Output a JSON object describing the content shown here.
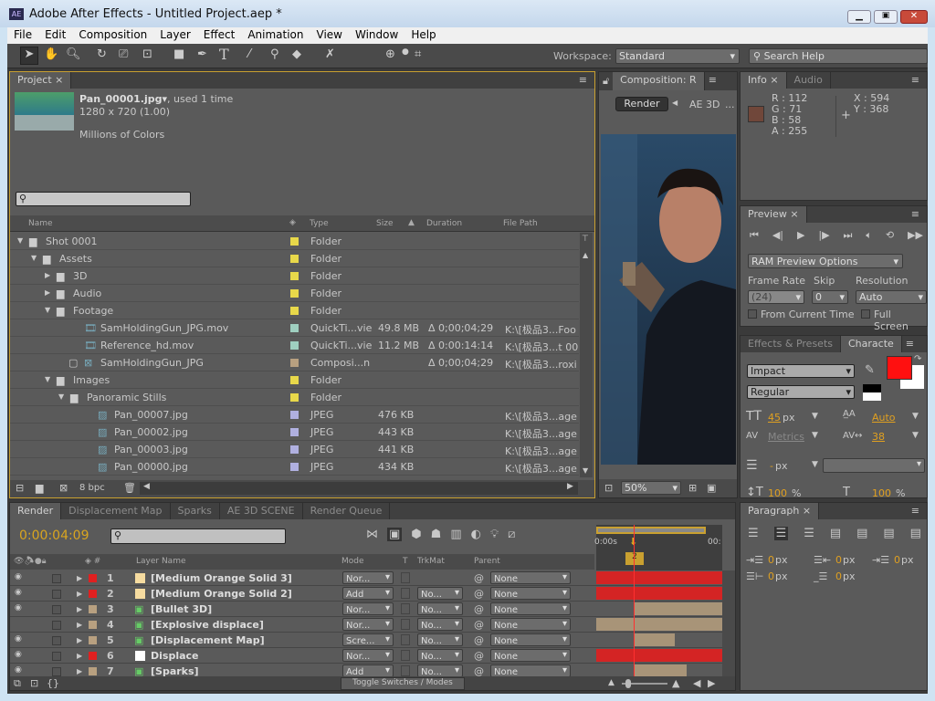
{
  "window": {
    "title": "Adobe After Effects - Untitled Project.aep *",
    "app_icon": "AE"
  },
  "menu": [
    "File",
    "Edit",
    "Composition",
    "Layer",
    "Effect",
    "Animation",
    "View",
    "Window",
    "Help"
  ],
  "toolbar": {
    "workspace_label": "Workspace:",
    "workspace_value": "Standard",
    "search_placeholder": "Search Help"
  },
  "project": {
    "tab": "Project",
    "item_name": "Pan_00001.jpg▾",
    "item_used": ", used 1 time",
    "item_dims": "1280 x 720 (1.00)",
    "item_colors": "Millions of Colors",
    "search_value": "",
    "bpc": "8 bpc",
    "columns": [
      "Name",
      "Type",
      "Size",
      "Duration",
      "File Path"
    ],
    "rows": [
      {
        "name": "Shot 0001",
        "indent": 0,
        "kind": "folder",
        "twirl": "open",
        "color": "#e8d84a",
        "type": "Folder",
        "size": "",
        "duration": "",
        "path": ""
      },
      {
        "name": "Assets",
        "indent": 1,
        "kind": "folder",
        "twirl": "open",
        "color": "#e8d84a",
        "type": "Folder",
        "size": "",
        "duration": "",
        "path": ""
      },
      {
        "name": "3D",
        "indent": 2,
        "kind": "folder",
        "twirl": "closed",
        "color": "#e8d84a",
        "type": "Folder",
        "size": "",
        "duration": "",
        "path": ""
      },
      {
        "name": "Audio",
        "indent": 2,
        "kind": "folder",
        "twirl": "closed",
        "color": "#e8d84a",
        "type": "Folder",
        "size": "",
        "duration": "",
        "path": ""
      },
      {
        "name": "Footage",
        "indent": 2,
        "kind": "folder",
        "twirl": "open",
        "color": "#e8d84a",
        "type": "Folder",
        "size": "",
        "duration": "",
        "path": ""
      },
      {
        "name": "SamHoldingGun_JPG.mov",
        "indent": 4,
        "kind": "movie",
        "twirl": "",
        "color": "#9fcfc0",
        "type": "QuickTi...vie",
        "size": "49.8 MB",
        "duration": "Δ 0;00;04;29",
        "path": "K:\\[极品3...Foo"
      },
      {
        "name": "Reference_hd.mov",
        "indent": 4,
        "kind": "movie",
        "twirl": "",
        "color": "#9fcfc0",
        "type": "QuickTi...vie",
        "size": "11.2 MB",
        "duration": "Δ 0:00:14:14",
        "path": "K:\\[极品3...t 00"
      },
      {
        "name": "SamHoldingGun_JPG",
        "indent": 4,
        "kind": "comp",
        "twirl": "",
        "color": "#b8a080",
        "type": "Composi...n",
        "size": "",
        "duration": "Δ 0;00;04;29",
        "path": "K:\\[极品3...roxi"
      },
      {
        "name": "Images",
        "indent": 2,
        "kind": "folder",
        "twirl": "open",
        "color": "#e8d84a",
        "type": "Folder",
        "size": "",
        "duration": "",
        "path": ""
      },
      {
        "name": "Panoramic Stills",
        "indent": 3,
        "kind": "folder",
        "twirl": "open",
        "color": "#e8d84a",
        "type": "Folder",
        "size": "",
        "duration": "",
        "path": ""
      },
      {
        "name": "Pan_00007.jpg",
        "indent": 5,
        "kind": "image",
        "twirl": "",
        "color": "#b0b0e0",
        "type": "JPEG",
        "size": "476 KB",
        "duration": "",
        "path": "K:\\[极品3...age"
      },
      {
        "name": "Pan_00002.jpg",
        "indent": 5,
        "kind": "image",
        "twirl": "",
        "color": "#b0b0e0",
        "type": "JPEG",
        "size": "443 KB",
        "duration": "",
        "path": "K:\\[极品3...age"
      },
      {
        "name": "Pan_00003.jpg",
        "indent": 5,
        "kind": "image",
        "twirl": "",
        "color": "#b0b0e0",
        "type": "JPEG",
        "size": "441 KB",
        "duration": "",
        "path": "K:\\[极品3...age"
      },
      {
        "name": "Pan_00000.jpg",
        "indent": 5,
        "kind": "image",
        "twirl": "",
        "color": "#b0b0e0",
        "type": "JPEG",
        "size": "434 KB",
        "duration": "",
        "path": "K:\\[极品3...age"
      }
    ]
  },
  "composition": {
    "tab": "Composition: R",
    "crumb_active": "Render",
    "crumb_next": "AE 3D",
    "crumb_more": "...",
    "zoom": "50%"
  },
  "info": {
    "tabs": [
      "Info",
      "Audio"
    ],
    "r": "R : 112",
    "g": "G : 71",
    "b": "B : 58",
    "a": "A : 255",
    "x": "X : 594",
    "y": "Y : 368",
    "sample_color": "#70473a"
  },
  "preview": {
    "tab": "Preview",
    "ram_options": "RAM Preview Options",
    "frame_rate_label": "Frame Rate",
    "skip_label": "Skip",
    "resolution_label": "Resolution",
    "frame_rate": "(24)",
    "skip": "0",
    "resolution": "Auto",
    "from_current": "From Current Time",
    "full_screen": "Full Screen",
    "from_current_checked": false,
    "full_screen_checked": false
  },
  "character": {
    "tabs": [
      "Effects & Presets",
      "Characte"
    ],
    "font": "Impact",
    "style": "Regular",
    "fill_color": "#ff1010",
    "size": "45",
    "size_unit": "px",
    "leading": "Auto",
    "kerning": "Metrics",
    "tracking": "38",
    "stroke": "-",
    "stroke_unit": "px",
    "vscale": "100",
    "hscale": "100",
    "pct": "%"
  },
  "paragraph": {
    "tab": "Paragraph",
    "indent_values": [
      "0",
      "0",
      "0",
      "0",
      "0"
    ],
    "unit": "px"
  },
  "timeline": {
    "tabs": [
      "Render",
      "Displacement Map",
      "Sparks",
      "AE 3D SCENE",
      "Render Queue"
    ],
    "timecode": "0:00:04:09",
    "search_value": "",
    "columns": [
      "Layer Name",
      "Mode",
      "T",
      "TrkMat",
      "Parent"
    ],
    "ruler_start": "0:00s",
    "ruler_end": "00:",
    "marker": "2",
    "toggle_label": "Toggle Switches / Modes",
    "layers": [
      {
        "num": "1",
        "name": "[Medium Orange Solid 3]",
        "label": "#e02020",
        "src": "solid",
        "src_color": "#f6dca0",
        "mode": "Nor...",
        "trkmat": "",
        "parent": "None",
        "visible": true,
        "bar_color": "#d42424",
        "bar_start": 0,
        "bar_end": 1
      },
      {
        "num": "2",
        "name": "[Medium Orange Solid 2]",
        "label": "#e02020",
        "src": "solid",
        "src_color": "#f6dca0",
        "mode": "Add",
        "trkmat": "No...",
        "parent": "None",
        "visible": true,
        "bar_color": "#d42424",
        "bar_start": 0,
        "bar_end": 1
      },
      {
        "num": "3",
        "name": "[Bullet 3D]",
        "label": "#b8a080",
        "src": "comp",
        "src_color": "",
        "mode": "Nor...",
        "trkmat": "No...",
        "parent": "None",
        "visible": true,
        "bar_color": "#a89478",
        "bar_start": 0.3,
        "bar_end": 1
      },
      {
        "num": "4",
        "name": "[Explosive displace]",
        "label": "#b8a080",
        "src": "comp",
        "src_color": "",
        "mode": "Nor...",
        "trkmat": "No...",
        "parent": "None",
        "visible": false,
        "bar_color": "#a89478",
        "bar_start": 0,
        "bar_end": 1
      },
      {
        "num": "5",
        "name": "[Displacement Map]",
        "label": "#b8a080",
        "src": "comp",
        "src_color": "",
        "mode": "Scre...",
        "trkmat": "No...",
        "parent": "None",
        "visible": true,
        "bar_color": "#a89478",
        "bar_start": 0.3,
        "bar_end": 0.62
      },
      {
        "num": "6",
        "name": "Displace",
        "label": "#e02020",
        "src": "solid",
        "src_color": "#ffffff",
        "mode": "Nor...",
        "trkmat": "No...",
        "parent": "None",
        "visible": true,
        "bar_color": "#d42424",
        "bar_start": 0,
        "bar_end": 1
      },
      {
        "num": "7",
        "name": "[Sparks]",
        "label": "#b8a080",
        "src": "comp",
        "src_color": "",
        "mode": "Add",
        "trkmat": "No...",
        "parent": "None",
        "visible": true,
        "bar_color": "#a89478",
        "bar_start": 0.3,
        "bar_end": 0.72
      }
    ],
    "playhead_fraction": 0.3
  }
}
